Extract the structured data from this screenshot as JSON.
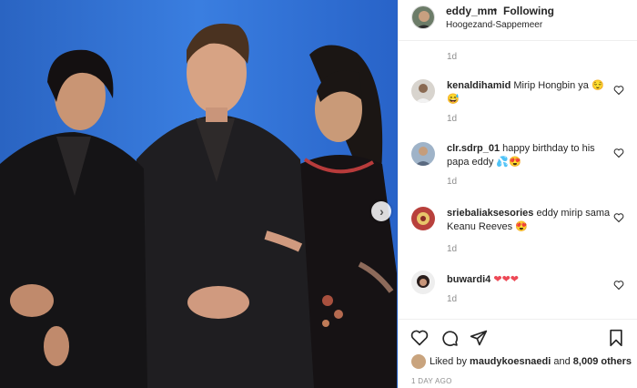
{
  "post": {
    "username": "eddy_mm",
    "separator": "•",
    "follow_status": "Following",
    "location": "Hoogezand-Sappemeer",
    "caption_age": "1d"
  },
  "comments": [
    {
      "username": "kenaldihamid",
      "text": "Mirip Hongbin ya 😌😅",
      "age": "1d"
    },
    {
      "username": "clr.sdrp_01",
      "text": "happy birthday to his papa eddy 💦😍",
      "age": "1d"
    },
    {
      "username": "sriebaliaksesories",
      "text": "eddy mirip sama Keanu Reeves 😍",
      "age": "1d"
    },
    {
      "username": "buwardi4",
      "text": "❤❤❤",
      "age": "1d"
    }
  ],
  "likes": {
    "prefix": "Liked by",
    "user": "maudykoesnaedi",
    "joiner": "and",
    "others": "8,009 others"
  },
  "date": "1 DAY AGO",
  "icons": {
    "like": "heart-outline-icon",
    "comment": "comment-bubble-icon",
    "share": "paper-plane-icon",
    "save": "bookmark-icon",
    "next": "chevron-right-icon",
    "comment_like": "small-heart-icon"
  },
  "colors": {
    "photo_background": "#2f6fd1",
    "secondary_text": "#8e8e8e",
    "primary_text": "#262626",
    "heart_red": "#ed4956"
  }
}
